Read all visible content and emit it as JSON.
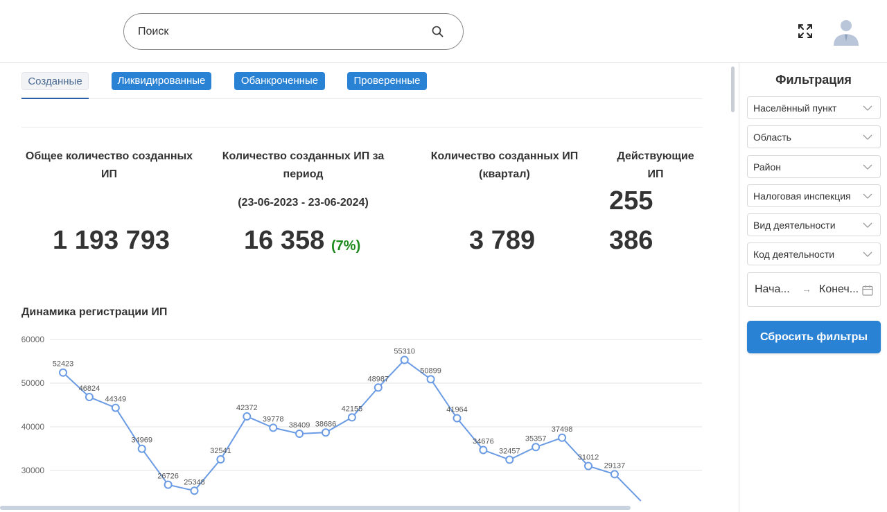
{
  "header": {
    "search_placeholder": "Поиск",
    "icons": [
      "search-icon",
      "fullscreen-icon",
      "user-avatar-icon"
    ]
  },
  "tabs": [
    {
      "label": "Созданные",
      "active": true
    },
    {
      "label": "Ликвидированные",
      "active": false
    },
    {
      "label": "Обанкроченные",
      "active": false
    },
    {
      "label": "Проверенные",
      "active": false
    }
  ],
  "stats": {
    "total": {
      "title": "Общее количество созданных ИП",
      "value": "1 193 793"
    },
    "period": {
      "title": "Количество созданных ИП за период",
      "range": "(23-06-2023 - 23-06-2024)",
      "value": "16 358",
      "pct": "(7%)"
    },
    "quarter": {
      "title": "Количество созданных ИП (квартал)",
      "value": "3 789"
    },
    "active": {
      "title": "Действующие ИП",
      "value_line1": "255",
      "value_line2": "386"
    }
  },
  "chart": {
    "title": "Динамика регистрации ИП"
  },
  "chart_data": {
    "type": "line",
    "title": "Динамика регистрации ИП",
    "y_ticks": [
      30000,
      40000,
      50000,
      60000
    ],
    "ylim": [
      30000,
      60000
    ],
    "grid": true,
    "series": [
      {
        "values": [
          52423,
          46824,
          44349,
          34969,
          26726,
          25348,
          32541,
          42372,
          39778,
          38409,
          38686,
          42155,
          48987,
          55310,
          50899,
          41964,
          34676,
          32457,
          35357,
          37498,
          31012,
          29137,
          23000
        ]
      }
    ],
    "labels": [
      "52423",
      "46824",
      "44349",
      "34969",
      "26726",
      "25348",
      "32541",
      "42372",
      "39778",
      "38409",
      "38686",
      "42155",
      "48987",
      "55310",
      "50899",
      "41964",
      "34676",
      "32457",
      "35357",
      "37498",
      "31012",
      "29137"
    ],
    "line_color": "#6a9be4"
  },
  "sidebar": {
    "title": "Фильтрация",
    "selects": [
      "Населённый пункт",
      "Область",
      "Район",
      "Налоговая инспекция",
      "Вид деятельности",
      "Код деятельности"
    ],
    "date_start": "Нача...",
    "date_arrow": "→",
    "date_end": "Конеч...",
    "reset_label": "Сбросить фильтры"
  },
  "colors": {
    "accent": "#2a82d4",
    "positive": "#1c8a1c"
  }
}
